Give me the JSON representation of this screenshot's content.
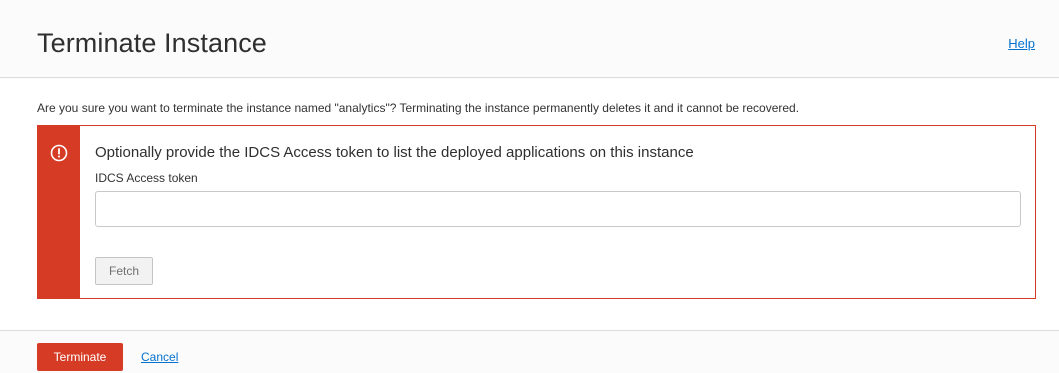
{
  "dialog": {
    "title": "Terminate Instance",
    "help_label": "Help"
  },
  "body": {
    "confirm_text": "Are you sure you want to terminate the instance named \"analytics\"? Terminating the instance permanently deletes it and it cannot be recovered."
  },
  "alert": {
    "icon": "exclamation-circle-icon",
    "heading": "Optionally provide the IDCS Access token to list the deployed applications on this instance",
    "field_label": "IDCS Access token",
    "token_value": "",
    "fetch_label": "Fetch"
  },
  "footer": {
    "terminate_label": "Terminate",
    "cancel_label": "Cancel"
  },
  "colors": {
    "danger": "#d63b25",
    "link": "#0572ce"
  }
}
